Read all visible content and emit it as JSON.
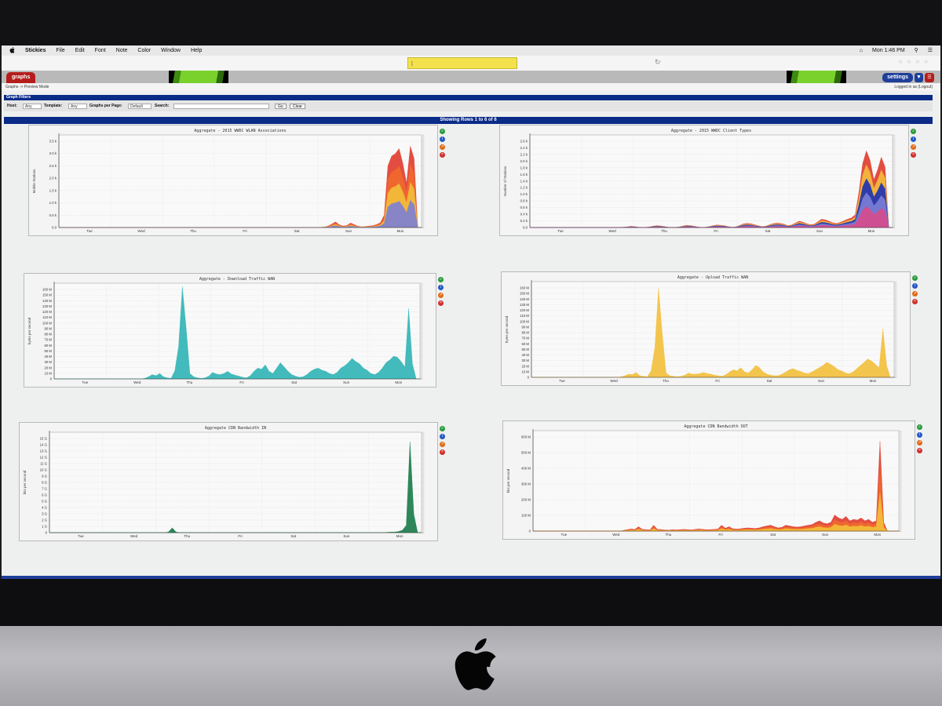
{
  "menubar": {
    "apple_icon": "apple-icon",
    "app_name": "Stickies",
    "menus": [
      "File",
      "Edit",
      "Font",
      "Note",
      "Color",
      "Window",
      "Help"
    ],
    "clock": "Mon 1:46 PM"
  },
  "sticky_note": {
    "text": "|"
  },
  "header": {
    "tab_label": "graphs",
    "settings_label": "settings"
  },
  "breadcrumb": {
    "text": "Graphs -> Preview Mode",
    "login": "Logged in as  (Logout)"
  },
  "filters": {
    "title": "Graph Filters",
    "host_label": "Host:",
    "host_value": "Any",
    "template_label": "Template:",
    "template_value": "Any",
    "per_page_label": "Graphs per Page:",
    "per_page_value": "Default",
    "search_label": "Search:",
    "go_label": "Go",
    "clear_label": "Clear"
  },
  "rows_label": "Showing Rows 1 to 6 of 6",
  "colors": {
    "accent_blue": "#0b2b88",
    "tab_red": "#b51d1d",
    "teal": "#2fb3b4",
    "amber": "#f2bf3a",
    "dark_green": "#167a49",
    "orange": "#ef6a2d",
    "red": "#e03a2c"
  },
  "chart_data": [
    {
      "type": "area",
      "title": "Aggregate - 2015 WWDC WLAN Associations",
      "ylabel": "Mobile Stations",
      "categories": [
        "Tue",
        "Wed",
        "Thu",
        "Fri",
        "Sat",
        "Sun",
        "Mon"
      ],
      "yticks": [
        "0.0",
        "0.5 k",
        "1.0 k",
        "1.5 k",
        "2.0 k",
        "2.5 k",
        "3.0 k",
        "3.5 k"
      ],
      "ylim": [
        0,
        3500
      ],
      "colors": [
        "#e03a2c",
        "#ef6a2d",
        "#f2bf3a",
        "#7b7fd6"
      ],
      "values": [
        0,
        0,
        0,
        0,
        0,
        0,
        0,
        0,
        0,
        0,
        0,
        0,
        0,
        0,
        0,
        0,
        0,
        0,
        0,
        0,
        0,
        0,
        0,
        0,
        0,
        0,
        0,
        0,
        0,
        0,
        0,
        0,
        0,
        0,
        0,
        0,
        0,
        0,
        0,
        0,
        0,
        0,
        0,
        0,
        0,
        0,
        0,
        0,
        0,
        0,
        0,
        0,
        0,
        0,
        0,
        0,
        0,
        0,
        0,
        0,
        0,
        0,
        0,
        0,
        0,
        0,
        0,
        0,
        0,
        0,
        10,
        20,
        60,
        140,
        230,
        110,
        60,
        80,
        180,
        120,
        50,
        30,
        40,
        60,
        80,
        120,
        200,
        500,
        2500,
        2900,
        3000,
        3200,
        2600,
        1800,
        3300,
        2800,
        0,
        0
      ]
    },
    {
      "type": "area",
      "title": "Aggregate - 2015 WWDC Client Types",
      "ylabel": "Number of Stations",
      "categories": [
        "Tue",
        "Wed",
        "Thu",
        "Fri",
        "Sat",
        "Sun",
        "Mon"
      ],
      "yticks": [
        "0.0",
        "0.2 k",
        "0.4 k",
        "0.6 k",
        "0.8 k",
        "1.0 k",
        "1.2 k",
        "1.4 k",
        "1.6 k",
        "1.8 k",
        "2.0 k",
        "2.2 k",
        "2.4 k",
        "2.6 k"
      ],
      "ylim": [
        0,
        2700
      ],
      "colors": [
        "#e03a2c",
        "#f2bf3a",
        "#1b2fb5",
        "#7b7fd6",
        "#d94b8b"
      ],
      "values": [
        0,
        0,
        0,
        0,
        0,
        0,
        0,
        0,
        0,
        0,
        0,
        0,
        0,
        0,
        0,
        0,
        0,
        0,
        0,
        0,
        0,
        0,
        0,
        0,
        5,
        10,
        20,
        40,
        30,
        10,
        5,
        8,
        20,
        45,
        60,
        50,
        30,
        10,
        5,
        8,
        20,
        50,
        70,
        60,
        40,
        15,
        5,
        10,
        30,
        60,
        80,
        70,
        60,
        30,
        10,
        20,
        60,
        110,
        130,
        120,
        90,
        60,
        30,
        40,
        80,
        120,
        140,
        130,
        100,
        60,
        80,
        140,
        200,
        170,
        120,
        90,
        100,
        180,
        260,
        240,
        200,
        150,
        130,
        160,
        210,
        260,
        300,
        400,
        1100,
        2000,
        2400,
        2100,
        1500,
        1800,
        2200,
        1900,
        0,
        0
      ]
    },
    {
      "type": "area",
      "title": "Aggregate - Download Traffic  WAN",
      "ylabel": "bytes per second",
      "categories": [
        "Tue",
        "Wed",
        "Thu",
        "Fri",
        "Sat",
        "Sun",
        "Mon"
      ],
      "yticks": [
        "0",
        "10 M",
        "20 M",
        "30 M",
        "40 M",
        "50 M",
        "60 M",
        "70 M",
        "80 M",
        "90 M",
        "100 M",
        "110 M",
        "120 M",
        "130 M",
        "140 M",
        "150 M",
        "160 M"
      ],
      "ylim": [
        0,
        165
      ],
      "colors": [
        "#2fb3b4"
      ],
      "values": [
        0,
        0,
        0,
        0,
        0,
        0,
        0,
        0,
        0,
        0,
        0,
        0,
        0,
        0,
        0,
        0,
        0,
        0,
        0,
        0,
        0,
        0,
        0,
        0,
        1,
        4,
        8,
        6,
        10,
        4,
        2,
        1,
        15,
        60,
        170,
        95,
        10,
        4,
        2,
        1,
        2,
        5,
        12,
        9,
        8,
        10,
        14,
        9,
        7,
        5,
        3,
        2,
        6,
        14,
        20,
        18,
        26,
        14,
        10,
        20,
        30,
        22,
        14,
        8,
        5,
        3,
        4,
        8,
        14,
        18,
        20,
        16,
        14,
        10,
        8,
        12,
        20,
        24,
        30,
        38,
        32,
        28,
        20,
        16,
        10,
        8,
        12,
        20,
        30,
        35,
        42,
        40,
        32,
        22,
        130,
        28,
        0,
        0
      ]
    },
    {
      "type": "area",
      "title": "Aggregate - Upload Traffic  WAN",
      "ylabel": "bytes per second",
      "categories": [
        "Tue",
        "Wed",
        "Thu",
        "Fri",
        "Sat",
        "Sun",
        "Mon"
      ],
      "yticks": [
        "0",
        "10 M",
        "20 M",
        "30 M",
        "40 M",
        "50 M",
        "60 M",
        "70 M",
        "80 M",
        "90 M",
        "100 M",
        "110 M",
        "120 M",
        "130 M",
        "140 M",
        "150 M",
        "160 M"
      ],
      "ylim": [
        0,
        165
      ],
      "colors": [
        "#f2bf3a"
      ],
      "values": [
        0,
        0,
        0,
        0,
        0,
        0,
        0,
        0,
        0,
        0,
        0,
        0,
        0,
        0,
        0,
        0,
        0,
        0,
        0,
        0,
        0,
        0,
        0,
        0,
        1,
        3,
        6,
        5,
        9,
        3,
        2,
        1,
        12,
        55,
        165,
        80,
        8,
        3,
        2,
        1,
        2,
        4,
        8,
        6,
        6,
        7,
        9,
        7,
        6,
        4,
        3,
        2,
        5,
        10,
        14,
        12,
        18,
        10,
        8,
        14,
        22,
        18,
        10,
        6,
        4,
        3,
        3,
        6,
        10,
        14,
        16,
        13,
        11,
        8,
        7,
        10,
        14,
        18,
        22,
        28,
        24,
        20,
        14,
        12,
        8,
        7,
        10,
        16,
        22,
        28,
        34,
        30,
        24,
        18,
        90,
        22,
        0,
        0
      ]
    },
    {
      "type": "area",
      "title": "Aggregate CDN Bandwidth IN",
      "ylabel": "bits per second",
      "categories": [
        "Tue",
        "Wed",
        "Thu",
        "Fri",
        "Sat",
        "Sun",
        "Mon"
      ],
      "yticks": [
        "0",
        "1 G",
        "2 G",
        "3 G",
        "4 G",
        "5 G",
        "6 G",
        "7 G",
        "8 G",
        "9 G",
        "10 G",
        "11 G",
        "12 G",
        "13 G",
        "14 G",
        "15 G"
      ],
      "ylim": [
        0,
        15.5
      ],
      "colors": [
        "#167a49"
      ],
      "values": [
        0,
        0,
        0,
        0,
        0,
        0,
        0,
        0,
        0,
        0,
        0,
        0,
        0,
        0,
        0,
        0,
        0,
        0,
        0,
        0,
        0,
        0,
        0,
        0,
        0,
        0,
        0,
        0,
        0,
        0,
        0,
        0.1,
        0.8,
        0.1,
        0,
        0,
        0,
        0,
        0,
        0,
        0,
        0,
        0,
        0,
        0,
        0,
        0,
        0,
        0,
        0,
        0,
        0,
        0,
        0,
        0,
        0,
        0,
        0,
        0,
        0,
        0,
        0,
        0,
        0,
        0,
        0,
        0,
        0,
        0,
        0,
        0,
        0,
        0,
        0,
        0,
        0,
        0,
        0,
        0,
        0,
        0,
        0,
        0,
        0,
        0,
        0,
        0,
        0,
        0.05,
        0.1,
        0.1,
        0.2,
        0.4,
        1.2,
        15,
        3,
        0,
        0
      ]
    },
    {
      "type": "area",
      "title": "Aggregate CDN Bandwidth OUT",
      "ylabel": "bits per second",
      "categories": [
        "Tue",
        "Wed",
        "Thu",
        "Fri",
        "Sat",
        "Sun",
        "Mon"
      ],
      "yticks": [
        "0",
        "100 M",
        "200 M",
        "300 M",
        "400 M",
        "500 M",
        "600 M"
      ],
      "ylim": [
        0,
        640
      ],
      "colors": [
        "#e03a2c",
        "#ef6a2d",
        "#f2bf3a"
      ],
      "values": [
        0,
        0,
        0,
        0,
        0,
        0,
        0,
        0,
        0,
        0,
        0,
        0,
        0,
        0,
        0,
        0,
        0,
        0,
        0,
        0,
        0,
        0,
        0,
        0,
        5,
        10,
        15,
        12,
        30,
        12,
        10,
        8,
        40,
        12,
        10,
        8,
        6,
        10,
        8,
        10,
        12,
        10,
        8,
        12,
        15,
        12,
        10,
        10,
        12,
        14,
        40,
        20,
        30,
        16,
        14,
        16,
        20,
        22,
        20,
        18,
        22,
        30,
        35,
        40,
        30,
        22,
        26,
        40,
        35,
        30,
        28,
        30,
        35,
        40,
        45,
        60,
        70,
        55,
        50,
        60,
        110,
        90,
        80,
        100,
        70,
        80,
        75,
        90,
        70,
        80,
        60,
        70,
        610,
        60,
        0,
        0,
        0,
        0
      ]
    }
  ]
}
